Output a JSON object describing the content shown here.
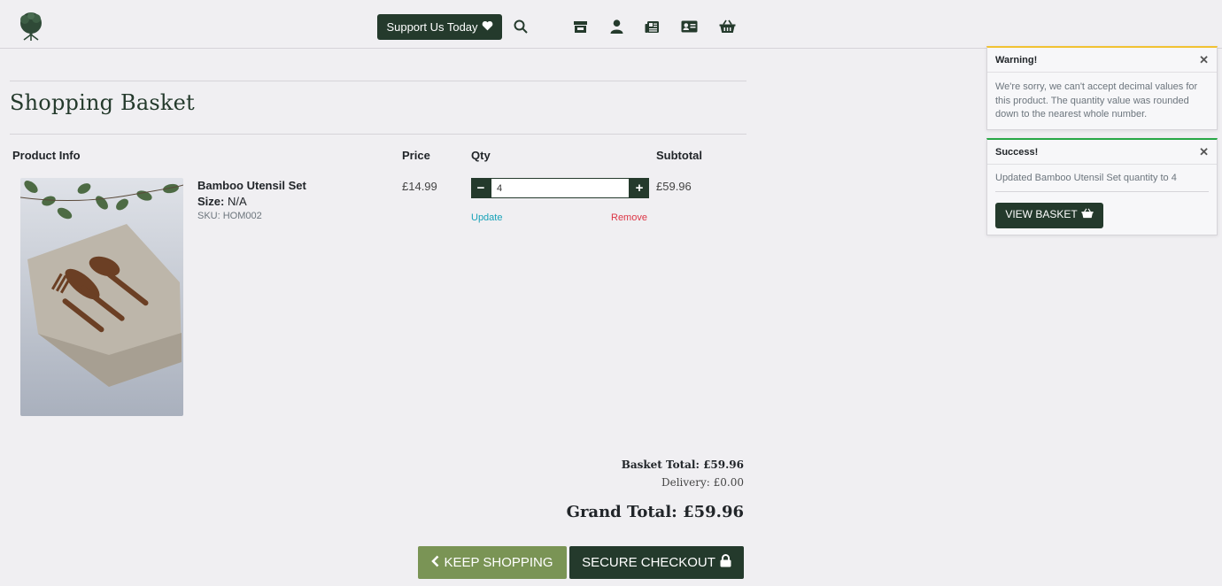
{
  "header": {
    "support_label": "Support Us Today",
    "icons": [
      "logo-tree-icon",
      "heart-icon",
      "search-icon",
      "store-icon",
      "user-icon",
      "newspaper-icon",
      "contact-card-icon",
      "basket-icon"
    ]
  },
  "main": {
    "title": "Shopping Basket",
    "columns": {
      "product": "Product Info",
      "price": "Price",
      "qty": "Qty",
      "subtotal": "Subtotal"
    },
    "item": {
      "name": "Bamboo Utensil Set",
      "size_label": "Size:",
      "size_value": "N/A",
      "sku": "SKU: HOM002",
      "price": "£14.99",
      "qty": "4",
      "subtotal": "£59.96",
      "update_label": "Update",
      "remove_label": "Remove"
    },
    "totals": {
      "basket_total": "Basket Total: £59.96",
      "delivery": "Delivery: £0.00",
      "grand_total": "Grand Total: £59.96"
    },
    "keep_shopping_label": "KEEP SHOPPING",
    "checkout_label": "SECURE CHECKOUT"
  },
  "toasts": {
    "warning": {
      "title": "Warning!",
      "message": "We're sorry, we can't accept decimal values for this product. The quantity value was rounded down to the nearest whole number."
    },
    "success": {
      "title": "Success!",
      "message": "Updated Bamboo Utensil Set quantity to 4",
      "button_label": "VIEW BASKET"
    }
  },
  "colors": {
    "brand_dark": "#243a2c",
    "brand_green": "#7a9455",
    "warning_accent": "#f1c232",
    "success_accent": "#28a745",
    "link_update": "#17a2b8",
    "link_remove": "#dc3545"
  }
}
